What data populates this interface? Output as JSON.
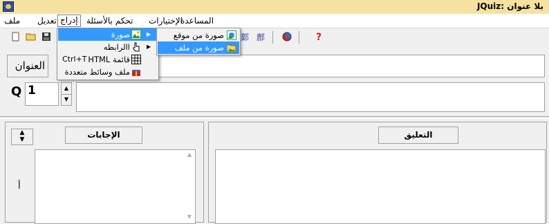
{
  "window": {
    "title": "بلا عنوان :JQuiz"
  },
  "menubar": {
    "file": "ملف",
    "edit": "تعديل",
    "insert": "إدراج",
    "manage_questions": "تحكم بالأسئلة",
    "options": "الإختيارات",
    "help": "المساعدة"
  },
  "insert_menu": {
    "image": "صورة",
    "link": "االرابطه",
    "html_table": "قائمة HTML",
    "html_table_shortcut": "Ctrl+T",
    "multimedia": "ملف وسائط متعددة"
  },
  "image_submenu": {
    "from_url": "صورة من موقع",
    "from_file": "صورة من ملف"
  },
  "toolbar": {
    "icons": [
      "new-icon",
      "open-icon",
      "save-icon",
      "image-icon",
      "tool1-icon",
      "tool2-icon",
      "tool3-icon",
      "web-icon",
      "help-icon"
    ],
    "help_symbol": "?"
  },
  "form": {
    "title_label": "العنوان",
    "question_prefix": "Q",
    "question_number": "1",
    "answers_header": "الإجابات",
    "feedback_header": "التعليق",
    "answer_letter": "أ"
  },
  "colors": {
    "titlebar": "#f6e2a0",
    "highlight": "#3399ff"
  }
}
